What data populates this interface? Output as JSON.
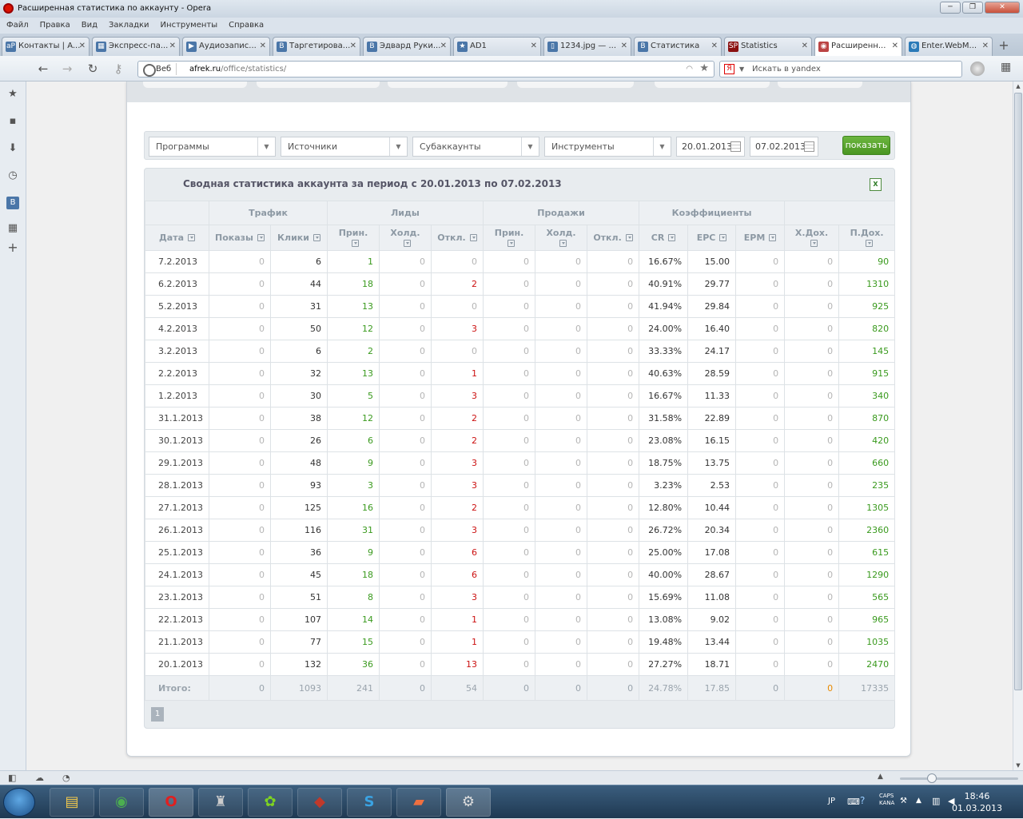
{
  "window": {
    "title": "Расширенная статистика по аккаунту - Opera"
  },
  "menu": [
    "Файл",
    "Правка",
    "Вид",
    "Закладки",
    "Инструменты",
    "Справка"
  ],
  "tabs": [
    {
      "icon": "aP",
      "label": "Контакты | A..."
    },
    {
      "icon": "▦",
      "label": "Экспресс-па..."
    },
    {
      "icon": "▶",
      "label": "Аудиозапис..."
    },
    {
      "icon": "B",
      "label": "Таргетирова..."
    },
    {
      "icon": "B",
      "label": "Эдвард Руки..."
    },
    {
      "icon": "★",
      "label": "AD1"
    },
    {
      "icon": "▯",
      "label": "1234.jpg — ..."
    },
    {
      "icon": "B",
      "label": "Статистика"
    },
    {
      "icon": "SP",
      "label": "Statistics"
    },
    {
      "icon": "◉",
      "label": "Расширенн..."
    },
    {
      "icon": "◍",
      "label": "Enter.WebM..."
    }
  ],
  "address": {
    "web_label": "Веб",
    "domain": "afrek.ru",
    "path": "/office/statistics/"
  },
  "search": {
    "engine_icon": "Я",
    "placeholder": "Искать в yandex"
  },
  "filters": {
    "programs": "Программы",
    "sources": "Источники",
    "subaccounts": "Субаккаунты",
    "tools": "Инструменты",
    "date_from": "20.01.2013",
    "date_to": "07.02.2013",
    "show_button": "показать"
  },
  "stats": {
    "title": "Сводная статистика аккаунта за период с 20.01.2013 по 07.02.2013",
    "groups": {
      "traffic": "Трафик",
      "leads": "Лиды",
      "sales": "Продажи",
      "coeffs": "Коэффициенты"
    },
    "columns": [
      "Дата",
      "Показы",
      "Клики",
      "Прин.",
      "Холд.",
      "Откл.",
      "Прин.",
      "Холд.",
      "Откл.",
      "CR",
      "EPC",
      "EPM",
      "Х.Дох.",
      "П.Дох."
    ],
    "rows": [
      [
        "7.2.2013",
        "0",
        "6",
        "1",
        "0",
        "0",
        "0",
        "0",
        "0",
        "16.67%",
        "15.00",
        "0",
        "0",
        "90"
      ],
      [
        "6.2.2013",
        "0",
        "44",
        "18",
        "0",
        "2",
        "0",
        "0",
        "0",
        "40.91%",
        "29.77",
        "0",
        "0",
        "1310"
      ],
      [
        "5.2.2013",
        "0",
        "31",
        "13",
        "0",
        "0",
        "0",
        "0",
        "0",
        "41.94%",
        "29.84",
        "0",
        "0",
        "925"
      ],
      [
        "4.2.2013",
        "0",
        "50",
        "12",
        "0",
        "3",
        "0",
        "0",
        "0",
        "24.00%",
        "16.40",
        "0",
        "0",
        "820"
      ],
      [
        "3.2.2013",
        "0",
        "6",
        "2",
        "0",
        "0",
        "0",
        "0",
        "0",
        "33.33%",
        "24.17",
        "0",
        "0",
        "145"
      ],
      [
        "2.2.2013",
        "0",
        "32",
        "13",
        "0",
        "1",
        "0",
        "0",
        "0",
        "40.63%",
        "28.59",
        "0",
        "0",
        "915"
      ],
      [
        "1.2.2013",
        "0",
        "30",
        "5",
        "0",
        "3",
        "0",
        "0",
        "0",
        "16.67%",
        "11.33",
        "0",
        "0",
        "340"
      ],
      [
        "31.1.2013",
        "0",
        "38",
        "12",
        "0",
        "2",
        "0",
        "0",
        "0",
        "31.58%",
        "22.89",
        "0",
        "0",
        "870"
      ],
      [
        "30.1.2013",
        "0",
        "26",
        "6",
        "0",
        "2",
        "0",
        "0",
        "0",
        "23.08%",
        "16.15",
        "0",
        "0",
        "420"
      ],
      [
        "29.1.2013",
        "0",
        "48",
        "9",
        "0",
        "3",
        "0",
        "0",
        "0",
        "18.75%",
        "13.75",
        "0",
        "0",
        "660"
      ],
      [
        "28.1.2013",
        "0",
        "93",
        "3",
        "0",
        "3",
        "0",
        "0",
        "0",
        "3.23%",
        "2.53",
        "0",
        "0",
        "235"
      ],
      [
        "27.1.2013",
        "0",
        "125",
        "16",
        "0",
        "2",
        "0",
        "0",
        "0",
        "12.80%",
        "10.44",
        "0",
        "0",
        "1305"
      ],
      [
        "26.1.2013",
        "0",
        "116",
        "31",
        "0",
        "3",
        "0",
        "0",
        "0",
        "26.72%",
        "20.34",
        "0",
        "0",
        "2360"
      ],
      [
        "25.1.2013",
        "0",
        "36",
        "9",
        "0",
        "6",
        "0",
        "0",
        "0",
        "25.00%",
        "17.08",
        "0",
        "0",
        "615"
      ],
      [
        "24.1.2013",
        "0",
        "45",
        "18",
        "0",
        "6",
        "0",
        "0",
        "0",
        "40.00%",
        "28.67",
        "0",
        "0",
        "1290"
      ],
      [
        "23.1.2013",
        "0",
        "51",
        "8",
        "0",
        "3",
        "0",
        "0",
        "0",
        "15.69%",
        "11.08",
        "0",
        "0",
        "565"
      ],
      [
        "22.1.2013",
        "0",
        "107",
        "14",
        "0",
        "1",
        "0",
        "0",
        "0",
        "13.08%",
        "9.02",
        "0",
        "0",
        "965"
      ],
      [
        "21.1.2013",
        "0",
        "77",
        "15",
        "0",
        "1",
        "0",
        "0",
        "0",
        "19.48%",
        "13.44",
        "0",
        "0",
        "1035"
      ],
      [
        "20.1.2013",
        "0",
        "132",
        "36",
        "0",
        "13",
        "0",
        "0",
        "0",
        "27.27%",
        "18.71",
        "0",
        "0",
        "2470"
      ]
    ],
    "totals": [
      "Итого:",
      "0",
      "1093",
      "241",
      "0",
      "54",
      "0",
      "0",
      "0",
      "24.78%",
      "17.85",
      "0",
      "0",
      "17335"
    ],
    "page": "1"
  },
  "taskbar": {
    "lang": "JP",
    "tray_text_1": "CAPS",
    "tray_text_2": "KANA",
    "time": "18:46",
    "date": "01.03.2013"
  },
  "colors": {
    "accept": "#3a9a1e",
    "reject": "#cc1111",
    "button": "#5aa62f"
  }
}
